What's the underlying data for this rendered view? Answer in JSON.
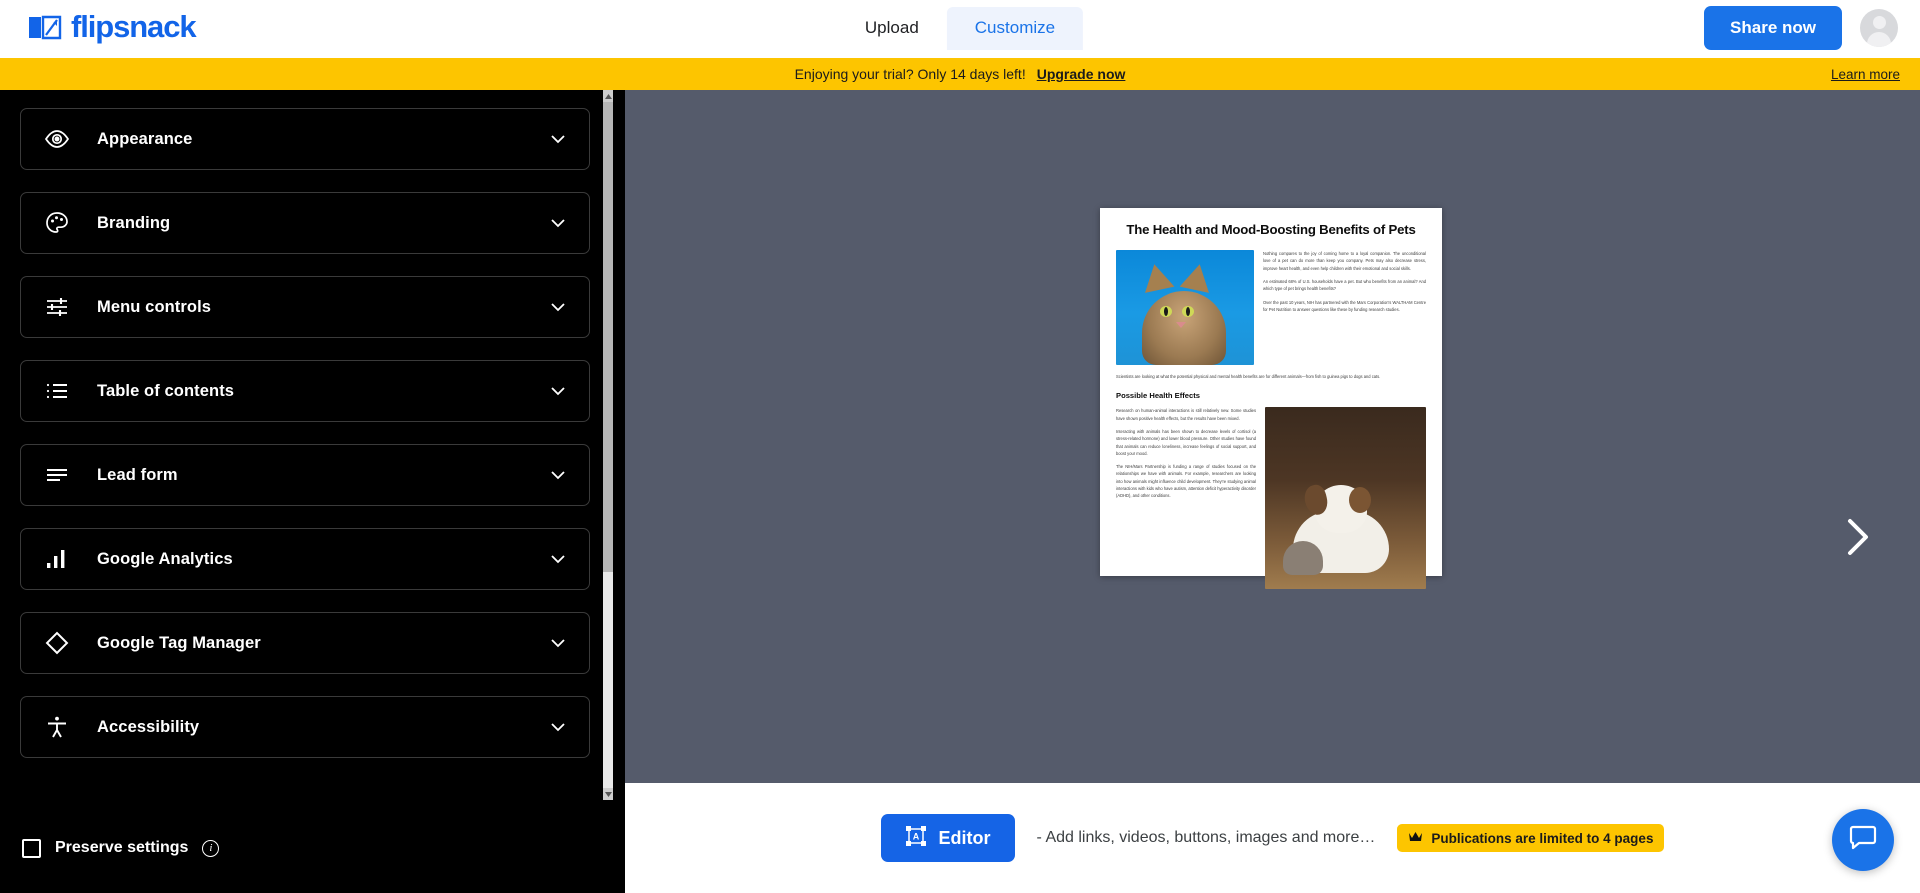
{
  "app": {
    "brand_name": "flipsnack",
    "brand_color": "#1264e8"
  },
  "header": {
    "tabs": [
      {
        "label": "Upload",
        "active": false
      },
      {
        "label": "Customize",
        "active": true
      }
    ],
    "share_button": "Share now",
    "avatar_name": "user-avatar"
  },
  "banner": {
    "message": "Enjoying your trial? Only 14 days left!",
    "upgrade_link": "Upgrade now",
    "learn_more": "Learn more",
    "background": "#fdc500"
  },
  "sidebar": {
    "items": [
      {
        "label": "Appearance",
        "icon": "eye-icon"
      },
      {
        "label": "Branding",
        "icon": "palette-icon"
      },
      {
        "label": "Menu controls",
        "icon": "sliders-icon"
      },
      {
        "label": "Table of contents",
        "icon": "list-icon"
      },
      {
        "label": "Lead form",
        "icon": "form-lines-icon"
      },
      {
        "label": "Google Analytics",
        "icon": "bar-chart-icon"
      },
      {
        "label": "Google Tag Manager",
        "icon": "diamond-icon"
      },
      {
        "label": "Accessibility",
        "icon": "accessibility-icon"
      }
    ],
    "preserve_settings": {
      "label": "Preserve settings",
      "checked": false,
      "info_glyph": "i"
    }
  },
  "preview": {
    "background": "#555b6b",
    "next_arrow": "chevron-right-icon",
    "document": {
      "title": "The Health and Mood-Boosting Benefits of Pets",
      "intro_paragraphs": [
        "Nothing compares to the joy of coming home to a loyal companion. The unconditional love of a pet can do more than keep you company. Pets may also decrease stress, improve heart health, and even help children with their emotional and social skills.",
        "An estimated 68% of U.S. households have a pet. But who benefits from an animal? And which type of pet brings health benefits?",
        "Over the past 10 years, NIH has partnered with the Mars Corporation's WALTHAM Centre for Pet Nutrition to answer questions like these by funding research studies."
      ],
      "wide_paragraph": "Scientists are looking at what the potential physical and mental health benefits are for different animals—from fish to guinea pigs to dogs and cats.",
      "section_heading": "Possible Health Effects",
      "body_paragraphs": [
        "Research on human-animal interactions is still relatively new. Some studies have shown positive health effects, but the results have been mixed.",
        "Interacting with animals has been shown to decrease levels of cortisol (a stress-related hormone) and lower blood pressure. Other studies have found that animals can reduce loneliness, increase feelings of social support, and boost your mood.",
        "The NIH/Mars Partnership is funding a range of studies focused on the relationships we have with animals. For example, researchers are looking into how animals might influence child development. They're studying animal interactions with kids who have autism, attention deficit hyperactivity disorder (ADHD), and other conditions."
      ]
    }
  },
  "bottom_bar": {
    "editor_button": "Editor",
    "editor_icon": "editor-frame-icon",
    "hint_text": "- Add links, videos, buttons, images and more…",
    "limit_badge": "Publications are limited to 4 pages",
    "limit_badge_icon": "crown-icon",
    "limit_badge_color": "#fdc500"
  },
  "chat": {
    "icon": "chat-bubble-icon",
    "color": "#1a73e8"
  }
}
